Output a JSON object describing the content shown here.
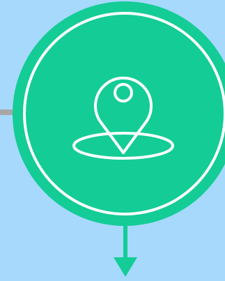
{
  "colors": {
    "background": "#a6d9fb",
    "accent": "#14cc96",
    "outline": "#ffffff",
    "connector": "#a7a7a7"
  },
  "icons": {
    "center": "map-pin-location-icon",
    "bottom": "arrow-down-icon"
  }
}
